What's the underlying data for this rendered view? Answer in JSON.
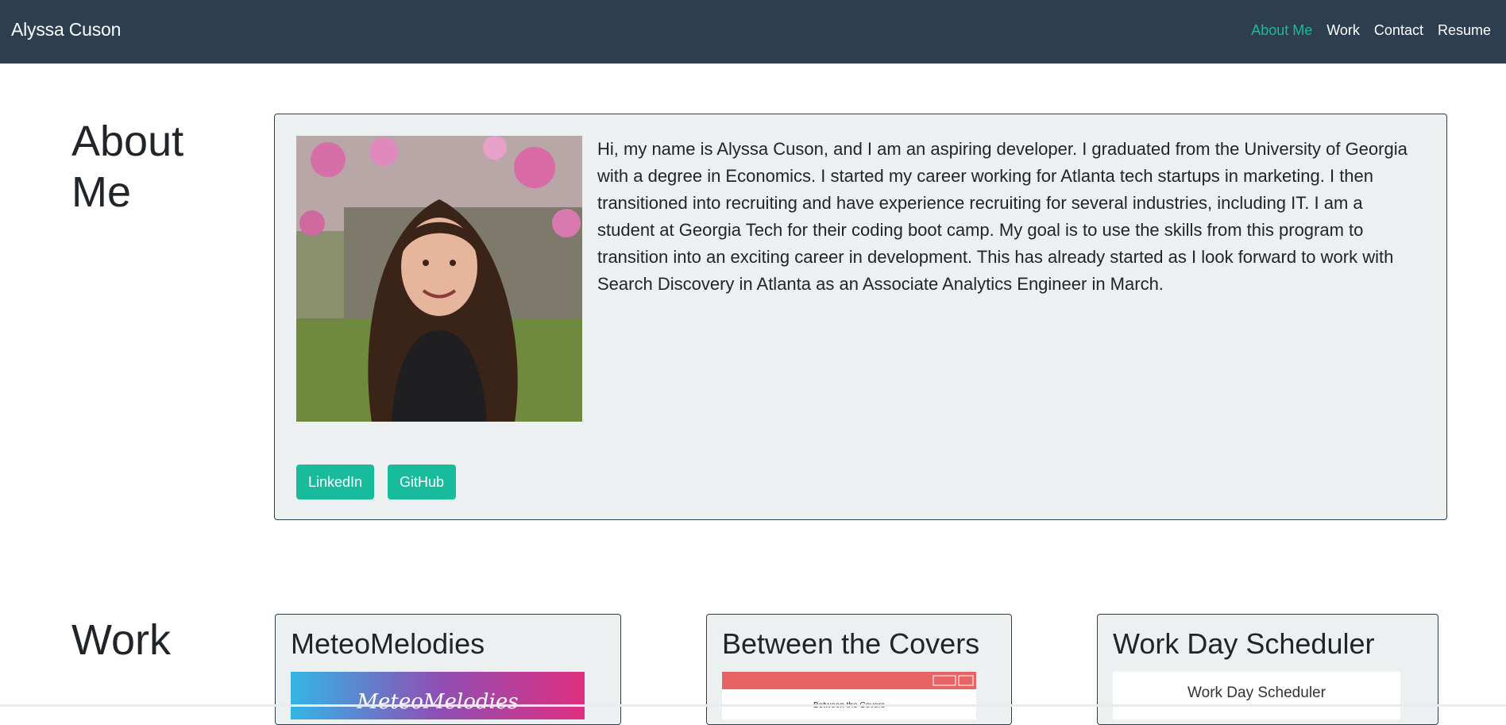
{
  "nav": {
    "brand": "Alyssa Cuson",
    "links": [
      "About Me",
      "Work",
      "Contact",
      "Resume"
    ]
  },
  "about": {
    "title": "About Me",
    "bio": "Hi, my name is Alyssa Cuson, and I am an aspiring developer. I graduated from the University of Georgia with a degree in Economics. I started my career working for Atlanta tech startups in marketing. I then transitioned into recruiting and have experience recruiting for several industries, including IT. I am a student at Georgia Tech for their coding boot camp. My goal is to use the skills from this program to transition into an exciting career in development. This has already started as I look forward to work with Search Discovery in Atlanta as an Associate Analytics Engineer in March.",
    "buttons": [
      "LinkedIn",
      "GitHub"
    ]
  },
  "work": {
    "title": "Work",
    "projects": [
      {
        "title": "MeteoMelodies",
        "thumb_text": "MeteoMelodies"
      },
      {
        "title": "Between the Covers",
        "thumb_text": "Between the Covers"
      },
      {
        "title": "Work Day Scheduler",
        "thumb_text": "Work Day Scheduler"
      }
    ]
  },
  "colors": {
    "navbar": "#2c3e50",
    "accent": "#18bc9c",
    "card_bg": "#ecf0f1"
  }
}
